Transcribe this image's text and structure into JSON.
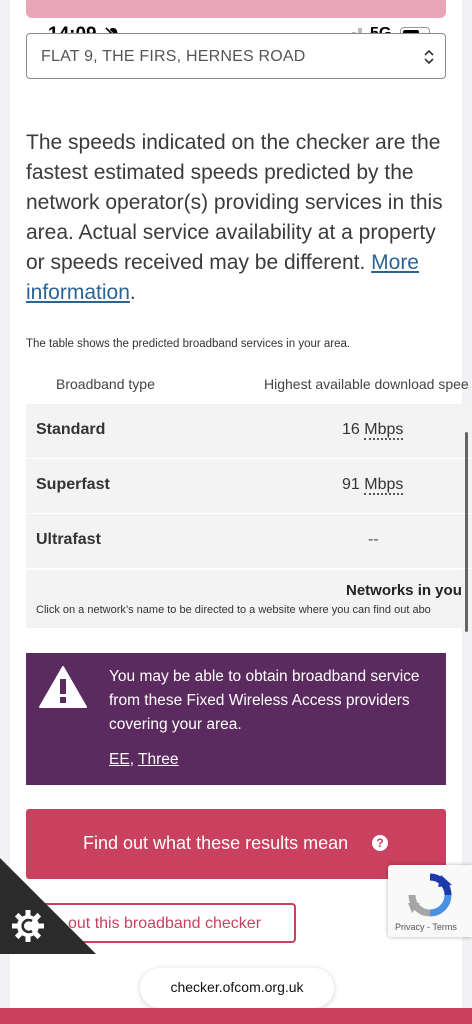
{
  "status_bar": {
    "time": "14:09",
    "network": "5G"
  },
  "address_select": {
    "value": "FLAT 9, THE FIRS, HERNES ROAD"
  },
  "intro": {
    "text": "The speeds indicated on the checker are the fastest estimated speeds predicted by the network operator(s) providing services in this area. Actual service availability at a property or speeds received may be different. ",
    "link": "More information",
    "suffix": "."
  },
  "table": {
    "caption": "The table shows the predicted broadband services in your area.",
    "headers": [
      "Broadband type",
      "Highest available download spee"
    ],
    "rows": [
      {
        "type": "Standard",
        "value": "16",
        "unit": "Mbps"
      },
      {
        "type": "Superfast",
        "value": "91",
        "unit": "Mbps"
      },
      {
        "type": "Ultrafast",
        "value": "--",
        "unit": ""
      }
    ],
    "networks_title": "Networks in you",
    "networks_note": "Click on a network’s name to be directed to a website where you can find out abo"
  },
  "fwa_notice": {
    "text": "You may be able to obtain broadband service from these Fixed Wireless Access providers covering your area.",
    "providers": [
      "EE",
      "Three"
    ],
    "separator": ", "
  },
  "buttons": {
    "find_out": "Find out what these results mean",
    "about": "out this broadband checker"
  },
  "recaptcha": {
    "terms": "Privacy - Terms"
  },
  "url_bar": {
    "url": "checker.ofcom.org.uk"
  },
  "colors": {
    "accent": "#c9415e",
    "notice_bg": "#5b2a5e",
    "link": "#2a6496"
  },
  "icons": {
    "bell": "bell-slash-icon",
    "warning": "warning-triangle-icon",
    "cookie": "cookie-icon",
    "help": "question-circle-icon",
    "chevron": "chevron-updown-icon"
  }
}
